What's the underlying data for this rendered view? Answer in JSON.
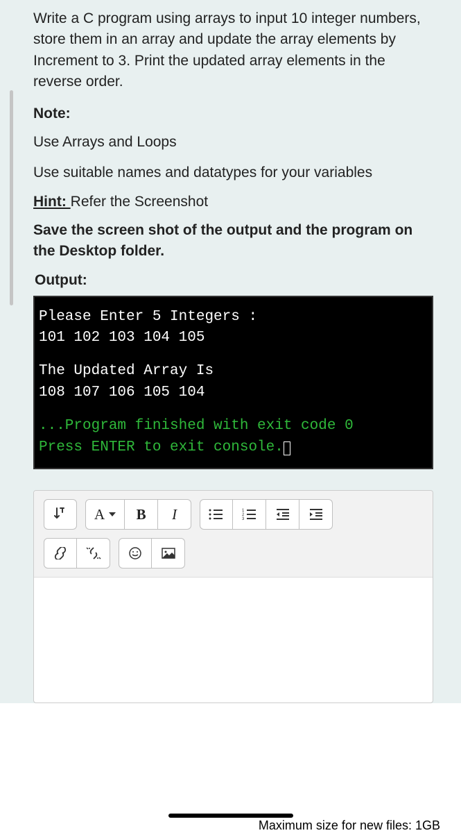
{
  "question": {
    "body": "Write a C program using arrays to input 10 integer numbers, store them in an array and update the array elements by Increment to 3. Print the updated array elements in the reverse order.",
    "note_label": "Note:",
    "note1": "Use Arrays and Loops",
    "note2": "Use suitable names and datatypes for your variables",
    "hint_label": "Hint: ",
    "hint_text": "Refer the Screenshot",
    "save_instruction": "Save the screen shot of the output and the program on the Desktop folder.",
    "output_label": "Output:"
  },
  "console": {
    "line1": "Please Enter 5 Integers :",
    "line2": "101 102 103 104 105",
    "line3": "The Updated Array Is",
    "line4": " 108 107 106 105 104",
    "line5": "...Program finished with exit code 0",
    "line6": "Press ENTER to exit console."
  },
  "toolbar": {
    "font_label": "A",
    "bold_label": "B",
    "italic_label": "I"
  },
  "footer": {
    "partial_text": "Maximum size for new files: 1GB"
  }
}
